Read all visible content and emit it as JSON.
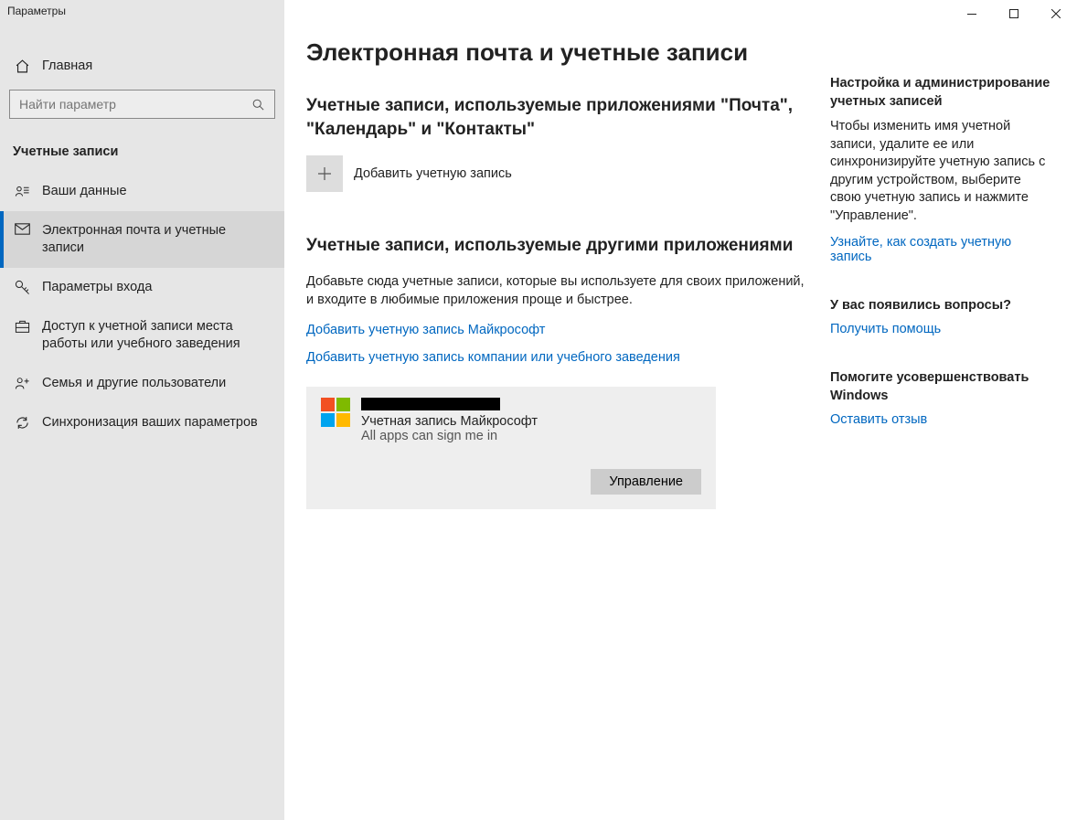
{
  "app_title": "Параметры",
  "home_label": "Главная",
  "search_placeholder": "Найти параметр",
  "section_label": "Учетные записи",
  "nav": [
    {
      "label": "Ваши данные"
    },
    {
      "label": "Электронная почта и учетные записи"
    },
    {
      "label": "Параметры входа"
    },
    {
      "label": "Доступ к учетной записи места работы или учебного заведения"
    },
    {
      "label": "Семья и другие пользователи"
    },
    {
      "label": "Синхронизация ваших параметров"
    }
  ],
  "page_heading": "Электронная почта и учетные записи",
  "section1_heading": "Учетные записи, используемые приложениями \"Почта\", \"Календарь\" и \"Контакты\"",
  "add_account_label": "Добавить учетную запись",
  "section2_heading": "Учетные записи, используемые другими приложениями",
  "section2_text": "Добавьте сюда учетные записи, которые вы используете для своих приложений, и входите в любимые приложения проще и быстрее.",
  "link_add_ms": "Добавить учетную запись Майкрософт",
  "link_add_work": "Добавить учетную запись компании или учебного заведения",
  "account_type": "Учетная запись Майкрософт",
  "account_status": "All apps can sign me in",
  "manage_label": "Управление",
  "aside": {
    "block1_title": "Настройка и администрирование учетных записей",
    "block1_text": "Чтобы изменить имя учетной записи, удалите ее или синхронизируйте учетную запись с другим устройством, выберите свою учетную запись и нажмите \"Управление\".",
    "block1_link": "Узнайте, как создать учетную запись",
    "block2_title": "У вас появились вопросы?",
    "block2_link": "Получить помощь",
    "block3_title": "Помогите усовершенствовать Windows",
    "block3_link": "Оставить отзыв"
  }
}
